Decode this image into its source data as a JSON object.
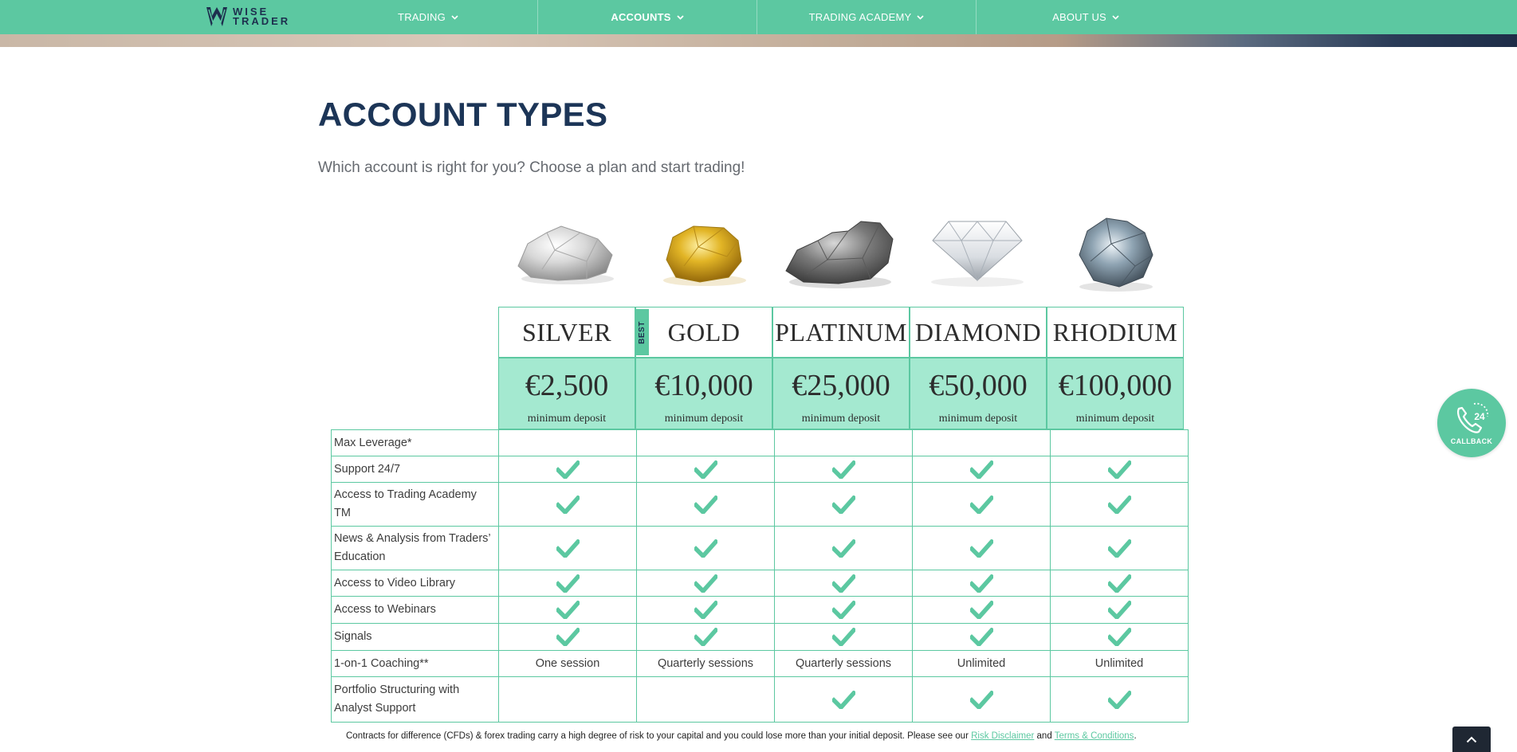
{
  "brand": {
    "name_line1": "WISE",
    "name_line2": "TRADER"
  },
  "nav": {
    "items": [
      {
        "label": "TRADING"
      },
      {
        "label": "ACCOUNTS"
      },
      {
        "label": "TRADING ACADEMY"
      },
      {
        "label": "ABOUT US"
      }
    ],
    "active": "ACCOUNTS"
  },
  "page": {
    "title": "ACCOUNT TYPES",
    "subtitle": "Which account is right for you? Choose a plan and start trading!"
  },
  "plans": [
    {
      "name": "SILVER",
      "price": "€2,500",
      "price_label": "minimum deposit",
      "image": "silver-nugget"
    },
    {
      "name": "GOLD",
      "price": "€10,000",
      "price_label": "minimum deposit",
      "image": "gold-nugget",
      "badge": "BEST"
    },
    {
      "name": "PLATINUM",
      "price": "€25,000",
      "price_label": "minimum deposit",
      "image": "platinum-nugget"
    },
    {
      "name": "DIAMOND",
      "price": "€50,000",
      "price_label": "minimum deposit",
      "image": "diamond"
    },
    {
      "name": "RHODIUM",
      "price": "€100,000",
      "price_label": "minimum deposit",
      "image": "rhodium-nugget"
    }
  ],
  "features": [
    {
      "label": "Max Leverage*",
      "values": [
        "",
        "",
        "",
        "",
        ""
      ]
    },
    {
      "label": "Support 24/7",
      "values": [
        "check",
        "check",
        "check",
        "check",
        "check"
      ]
    },
    {
      "label": "Access to Trading Academy TM",
      "values": [
        "check",
        "check",
        "check",
        "check",
        "check"
      ]
    },
    {
      "label": "News & Analysis from Traders’ Education",
      "values": [
        "check",
        "check",
        "check",
        "check",
        "check"
      ]
    },
    {
      "label": "Access to Video Library",
      "values": [
        "check",
        "check",
        "check",
        "check",
        "check"
      ]
    },
    {
      "label": "Access to Webinars",
      "values": [
        "check",
        "check",
        "check",
        "check",
        "check"
      ]
    },
    {
      "label": "Signals",
      "values": [
        "check",
        "check",
        "check",
        "check",
        "check"
      ]
    },
    {
      "label": "1-on-1 Coaching**",
      "values": [
        "One session",
        "Quarterly sessions",
        "Quarterly sessions",
        "Unlimited",
        "Unlimited"
      ]
    },
    {
      "label": "Portfolio Structuring with Analyst Support",
      "values": [
        "",
        "",
        "check",
        "check",
        "check"
      ]
    }
  ],
  "disclaimer": {
    "text": "Contracts for difference (CFDs) & forex trading carry a high degree of risk to your capital and you could lose more than your initial deposit. Please see our ",
    "link1": "Risk Disclaimer",
    "and": " and ",
    "link2": "Terms & Conditions",
    "end": "."
  },
  "callback": {
    "number": "24",
    "label": "CALLBACK"
  },
  "colors": {
    "accent": "#5cc8a1",
    "accent_light": "#a4e9d0",
    "title": "#1c3557"
  }
}
